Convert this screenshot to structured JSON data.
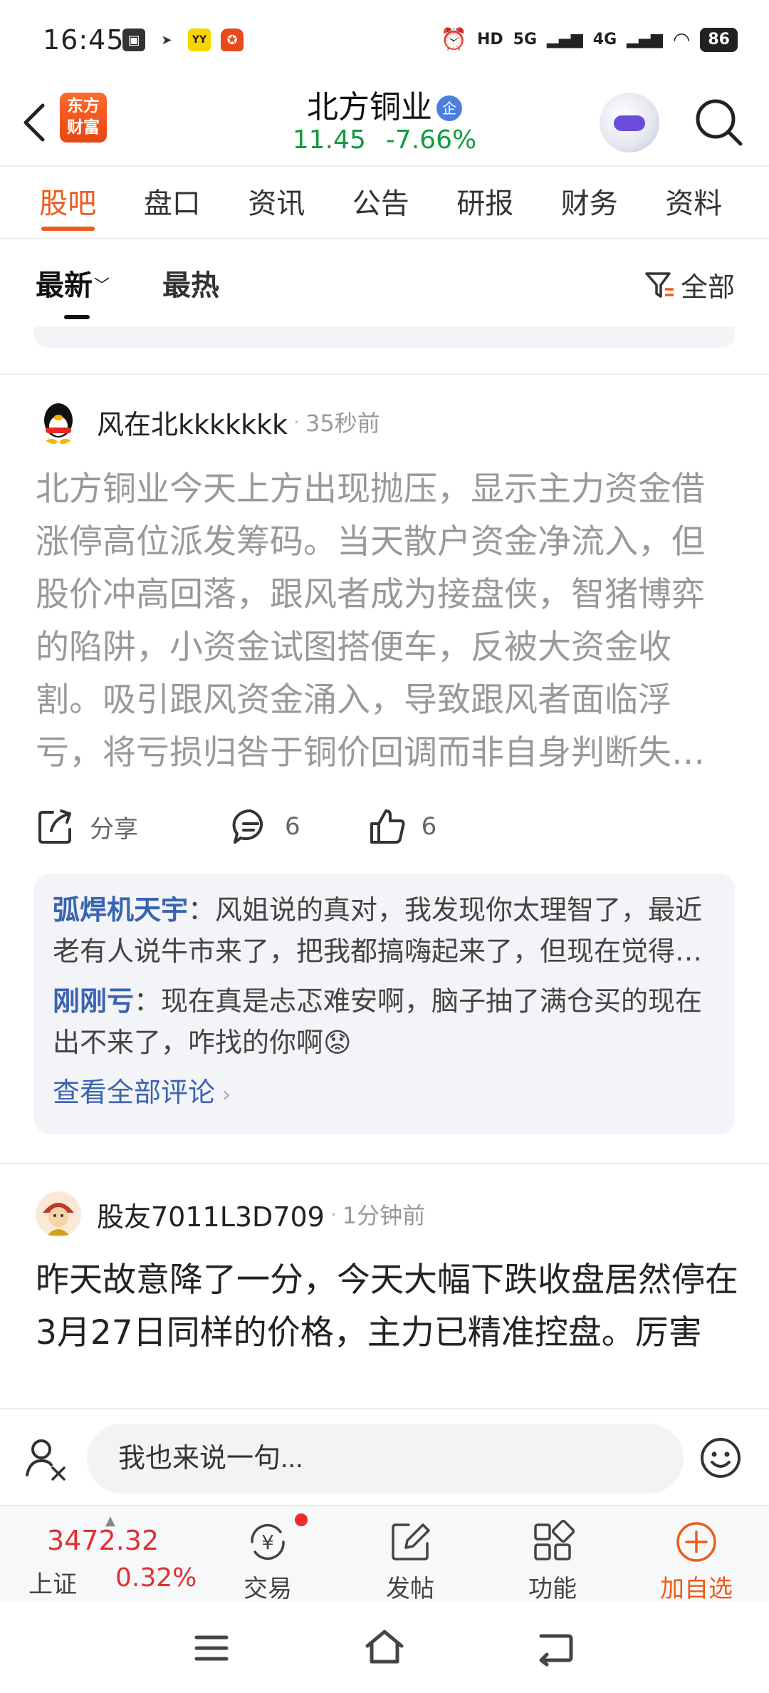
{
  "status_bar": {
    "time": "16:45",
    "network": "5G",
    "network2": "4G",
    "battery": "86"
  },
  "header": {
    "logo_text": "东方财富",
    "stock_name": "北方铜业",
    "enterprise_badge": "企",
    "price": "11.45",
    "change_pct": "-7.66%"
  },
  "tabs": [
    {
      "label": "股吧",
      "active": true
    },
    {
      "label": "盘口"
    },
    {
      "label": "资讯"
    },
    {
      "label": "公告"
    },
    {
      "label": "研报"
    },
    {
      "label": "财务"
    },
    {
      "label": "资料"
    }
  ],
  "sort": {
    "latest": "最新",
    "hot": "最热",
    "filter": "全部"
  },
  "posts": [
    {
      "author": "风在北kkkkkkk",
      "time": "35秒前",
      "body": "北方铜业今天上方出现抛压，显示主力资金借涨停高位派发筹码。当天散户资金净流入，但股价冲高回落，跟风者成为接盘侠，智猪博弈的陷阱，小资金试图搭便车，反被大资金收割。吸引跟风资金涌入，导致跟风者面临浮亏，将亏损归咎于铜价回调而非自身判断失误。",
      "share_label": "分享",
      "comments_count": "6",
      "likes_count": "6",
      "comments": [
        {
          "author": "弧焊机天宇",
          "text": "：风姐说的真对，我发现你太理智了，最近老有人说牛市来了，把我都搞嗨起来了，但现在觉得还是要冷静。"
        },
        {
          "author": "刚刚亏",
          "text": "：现在真是忐忑难安啊，脑子抽了满仓买的现在出不来了，咋找的你啊😟"
        }
      ],
      "view_all": "查看全部评论"
    },
    {
      "author": "股友7011L3D709",
      "time": "1分钟前",
      "body": "昨天故意降了一分，今天大幅下跌收盘居然停在3月27日同样的价格，主力已精准控盘。厉害"
    }
  ],
  "input": {
    "placeholder": "我也来说一句..."
  },
  "bottom_nav": {
    "index_name": "上证",
    "index_value": "3472.32",
    "index_change": "0.32%",
    "items": [
      {
        "label": "交易"
      },
      {
        "label": "发帖"
      },
      {
        "label": "功能"
      },
      {
        "label": "加自选"
      }
    ]
  },
  "colors": {
    "brand_orange": "#f05a1a",
    "down_green": "#149b40",
    "up_red": "#e03030",
    "link_blue": "#3a64b0"
  }
}
